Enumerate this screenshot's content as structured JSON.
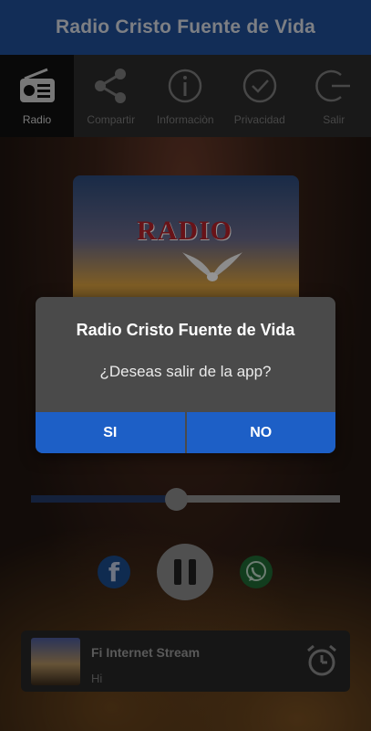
{
  "app": {
    "title": "Radio Cristo Fuente de Vida",
    "accent": "#1d5fc6"
  },
  "nav": {
    "items": [
      {
        "label": "Radio",
        "icon": "radio-icon"
      },
      {
        "label": "Compartir",
        "icon": "share-icon"
      },
      {
        "label": "Informaciòn",
        "icon": "info-icon"
      },
      {
        "label": "Privacidad",
        "icon": "check-circle-icon"
      },
      {
        "label": "Salir",
        "icon": "exit-icon"
      }
    ]
  },
  "cover": {
    "text": "RADIO"
  },
  "dialog": {
    "title": "Radio Cristo Fuente de Vida",
    "message": "¿Deseas salir de la app?",
    "yes_label": "SI",
    "no_label": "NO"
  },
  "volume": {
    "level": 0.47
  },
  "player": {
    "title": "Fi Internet Stream",
    "subtitle": "Hi"
  }
}
